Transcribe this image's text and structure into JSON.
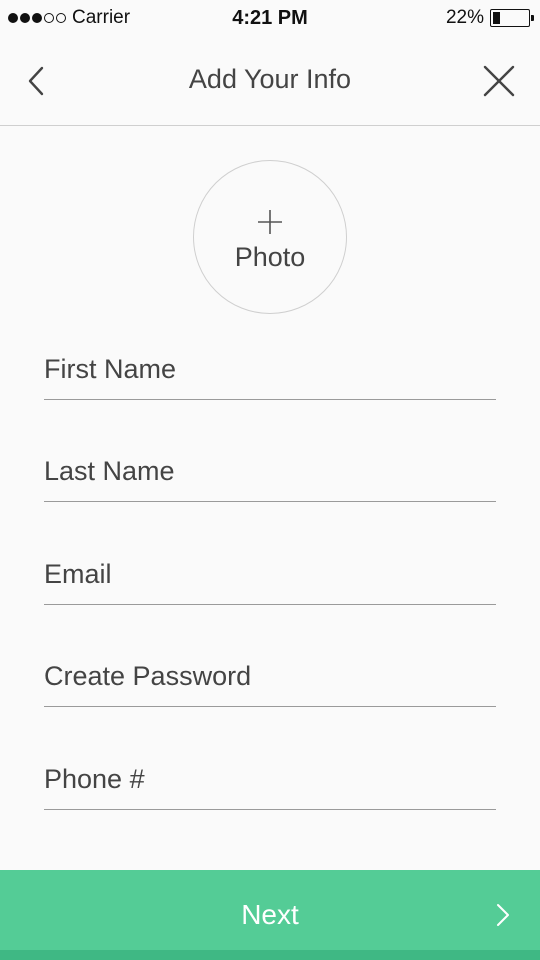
{
  "status_bar": {
    "carrier": "Carrier",
    "time": "4:21 PM",
    "battery_text": "22%",
    "signal_filled": 3,
    "signal_total": 5,
    "battery_level": 0.22
  },
  "nav": {
    "title": "Add Your Info",
    "back_icon": "chevron-left-icon",
    "close_icon": "close-icon"
  },
  "photo": {
    "label": "Photo",
    "icon": "plus-icon"
  },
  "form": {
    "first_name": {
      "placeholder": "First Name",
      "value": ""
    },
    "last_name": {
      "placeholder": "Last Name",
      "value": ""
    },
    "email": {
      "placeholder": "Email",
      "value": ""
    },
    "password": {
      "placeholder": "Create Password",
      "value": ""
    },
    "phone": {
      "placeholder": "Phone #",
      "value": ""
    }
  },
  "next_button": {
    "label": "Next",
    "icon": "chevron-right-icon"
  },
  "colors": {
    "accent": "#54cc96",
    "text": "#444444",
    "background": "#fafafa"
  }
}
